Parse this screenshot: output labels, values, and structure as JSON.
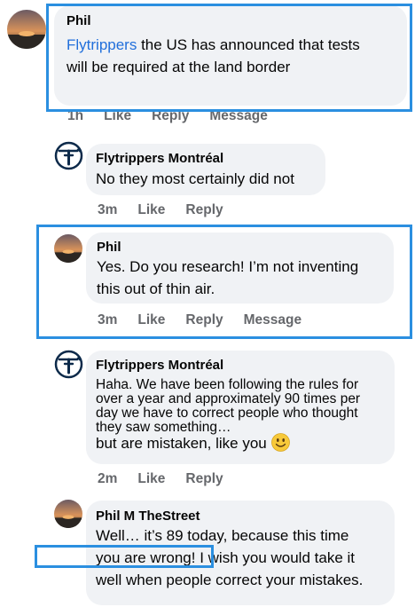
{
  "comments": [
    {
      "author": "Phil",
      "mention": "Flytrippers",
      "text_line1": " the US has announced that tests",
      "text_line2": "will be required at the land border",
      "actions": {
        "time": "1h",
        "like": "Like",
        "reply": "Reply",
        "message": "Message"
      }
    },
    {
      "author": "Flytrippers Montréal",
      "text": "No they most certainly did not",
      "actions": {
        "time": "3m",
        "like": "Like",
        "reply": "Reply"
      }
    },
    {
      "author": "Phil",
      "text_line1": "Yes. Do you research! I’m not inventing",
      "text_line2": "this out of thin air.",
      "actions": {
        "time": "3m",
        "like": "Like",
        "reply": "Reply",
        "message": "Message"
      }
    },
    {
      "author": "Flytrippers Montréal",
      "text_line1": "Haha. We have been following the rules for",
      "text_line2": "over a year and approximately 90 times per",
      "text_line3": "day we have to correct people who thought",
      "text_line4": "they saw something…",
      "text_line5": "but are mistaken, like you",
      "emoji": "slightly-smiling-face",
      "actions": {
        "time": "2m",
        "like": "Like",
        "reply": "Reply"
      }
    },
    {
      "author": "Phil M TheStreet",
      "text_line1": "Well… it’s 89 today, because this time",
      "text_line2a": "you are wrong! ",
      "text_line2b": "I wish you would take it",
      "text_line3": "well when people correct your mistakes."
    }
  ],
  "icons": {
    "brand_avatar": "airplane-logo-icon",
    "user_avatar": "sunset-photo-avatar"
  },
  "colors": {
    "highlight": "#2b8fe0",
    "link": "#216fdb",
    "bubble": "#f0f2f5",
    "meta": "#65676b"
  }
}
